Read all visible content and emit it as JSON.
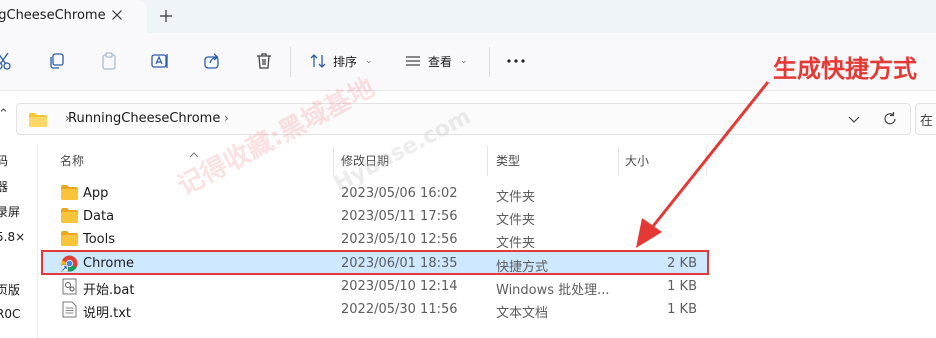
{
  "tab": {
    "title": "ngCheeseChrome"
  },
  "toolbar": {
    "sort_label": "排序",
    "view_label": "查看"
  },
  "address": {
    "path": "RunningCheeseChrome"
  },
  "search": {
    "placeholder_fragment": "在"
  },
  "nav_pane": {
    "items": [
      "码",
      "器",
      "录屏",
      "5.8×",
      "页版",
      "R0C"
    ]
  },
  "columns": {
    "name": "名称",
    "modified": "修改日期",
    "type": "类型",
    "size": "大小"
  },
  "files": [
    {
      "name": "App",
      "modified": "2023/05/06 16:02",
      "type": "文件夹",
      "size": "",
      "icon": "folder-icon"
    },
    {
      "name": "Data",
      "modified": "2023/05/11 17:56",
      "type": "文件夹",
      "size": "",
      "icon": "folder-icon"
    },
    {
      "name": "Tools",
      "modified": "2023/05/10 12:56",
      "type": "文件夹",
      "size": "",
      "icon": "folder-icon"
    },
    {
      "name": "Chrome",
      "modified": "2023/06/01 18:35",
      "type": "快捷方式",
      "size": "2 KB",
      "icon": "chrome-shortcut-icon",
      "selected": true
    },
    {
      "name": "开始.bat",
      "modified": "2023/05/10 12:14",
      "type": "Windows 批处理...",
      "size": "1 KB",
      "icon": "batch-file-icon"
    },
    {
      "name": "说明.txt",
      "modified": "2022/05/30 11:56",
      "type": "文本文档",
      "size": "1 KB",
      "icon": "text-file-icon"
    }
  ],
  "watermark": {
    "cn": "记得收藏:黑域基地",
    "en": "Hybase.com"
  },
  "annotation": {
    "label": "生成快捷方式"
  },
  "colors": {
    "selection": "#cde8ff",
    "annotation_red": "#e53935",
    "folder_yellow": "#f8c43a"
  }
}
